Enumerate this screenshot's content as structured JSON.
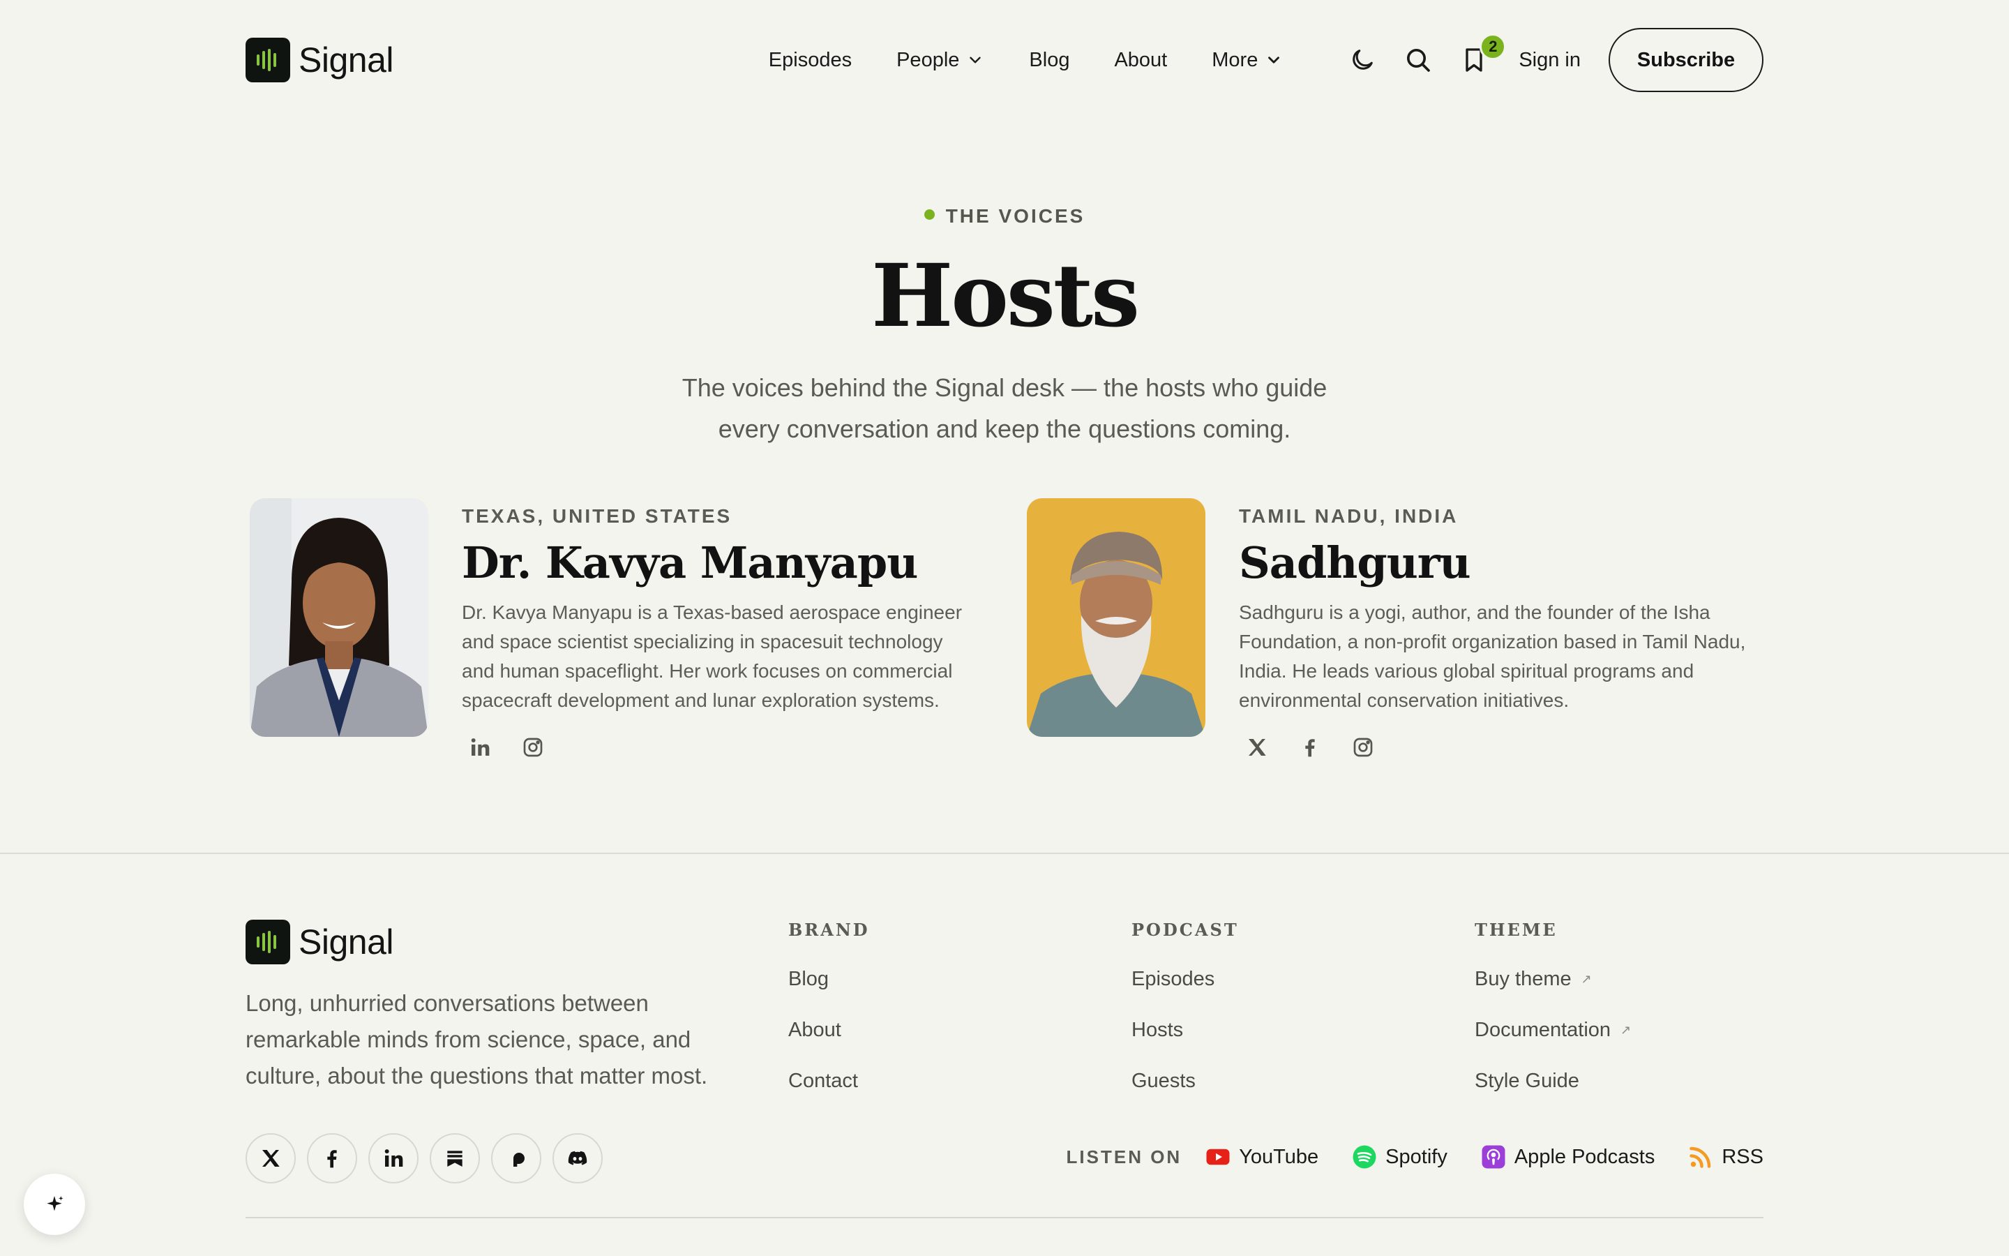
{
  "brand": {
    "name": "Signal",
    "logo_icon": "waveform-icon",
    "accent": "#8bc53f"
  },
  "nav": {
    "items": [
      "Episodes",
      "People",
      "Blog",
      "About",
      "More"
    ],
    "bookmark_count": "2",
    "signin": "Sign in",
    "subscribe": "Subscribe"
  },
  "hero": {
    "eyebrow": "THE VOICES",
    "title": "Hosts",
    "subtitle_line1": "The voices behind the Signal desk — the hosts who guide",
    "subtitle_line2": "every conversation and keep the questions coming."
  },
  "hosts": [
    {
      "location": "TEXAS, UNITED STATES",
      "name": "Dr. Kavya Manyapu",
      "bio": "Dr. Kavya Manyapu is a Texas-based aerospace engineer and space scientist specializing in spacesuit technology and human spaceflight. Her work focuses on commercial spacecraft development and lunar exploration systems.",
      "socials": [
        "linkedin-icon",
        "instagram-icon"
      ]
    },
    {
      "location": "TAMIL NADU, INDIA",
      "name": "Sadhguru",
      "bio": "Sadhguru is a yogi, author, and the founder of the Isha Foundation, a non-profit organization based in Tamil Nadu, India. He leads various global spiritual programs and environmental conservation initiatives.",
      "socials": [
        "x-icon",
        "facebook-icon",
        "instagram-icon"
      ]
    }
  ],
  "footer": {
    "tagline": "Long, unhurried conversations between remarkable minds from science, space, and culture, about the questions that matter most.",
    "columns": [
      {
        "heading": "BRAND",
        "links": [
          "Blog",
          "About",
          "Contact"
        ]
      },
      {
        "heading": "PODCAST",
        "links": [
          "Episodes",
          "Hosts",
          "Guests"
        ]
      },
      {
        "heading": "THEME",
        "links": [
          "Buy theme",
          "Documentation",
          "Style Guide"
        ]
      }
    ],
    "listen_label": "LISTEN ON",
    "platforms": [
      "YouTube",
      "Spotify",
      "Apple Podcasts",
      "RSS"
    ]
  }
}
